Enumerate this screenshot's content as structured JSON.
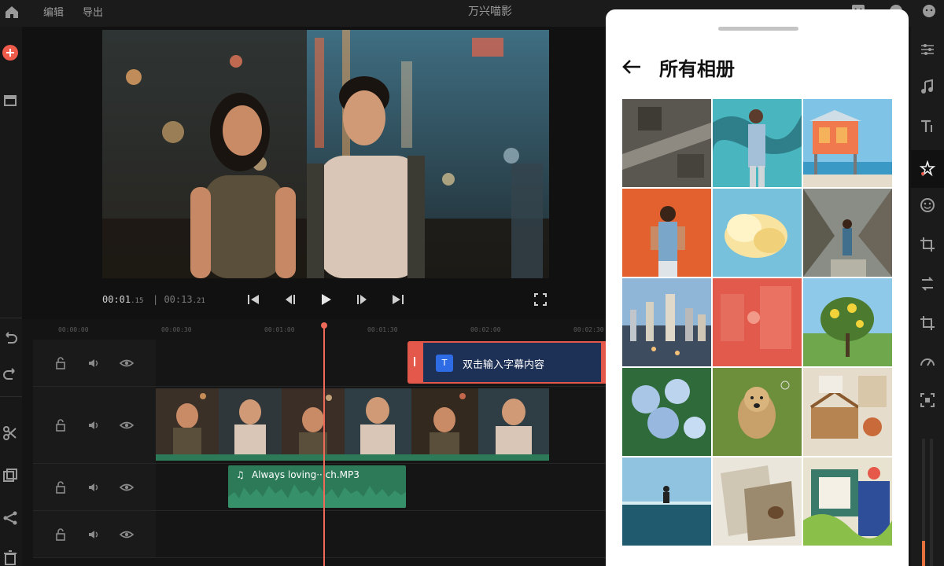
{
  "app": {
    "title": "万兴喵影",
    "menu": [
      "编辑",
      "导出"
    ]
  },
  "player": {
    "current_time": "00:01",
    "current_frames": ".15",
    "total_time": "00:13",
    "total_frames": ".21"
  },
  "ruler": {
    "ticks": [
      "00:00:00",
      "00:00:30",
      "00:01:00",
      "00:01:30",
      "00:02:00",
      "00:02:30"
    ]
  },
  "timeline": {
    "subtitle_badge": "T",
    "subtitle_text": "双击输入字幕内容",
    "audio_label": "Always loving···ch.MP3"
  },
  "album_panel": {
    "title": "所有相册",
    "photos": [
      "city-aerial",
      "graffiti-man",
      "lifeguard-tower",
      "woman-orange-wall",
      "yellow-cloud",
      "forest-path",
      "city-skyline",
      "red-street",
      "yellow-tree",
      "blue-hydrangea",
      "dog-grass",
      "picnic",
      "surfer-sea",
      "paper-flatlay",
      "mural-wall"
    ]
  },
  "colors": {
    "accent": "#ee6a58",
    "subtitle_clip": "#e3584a",
    "audio_clip": "#2d7a59",
    "badge_blue": "#2e6ce6"
  }
}
